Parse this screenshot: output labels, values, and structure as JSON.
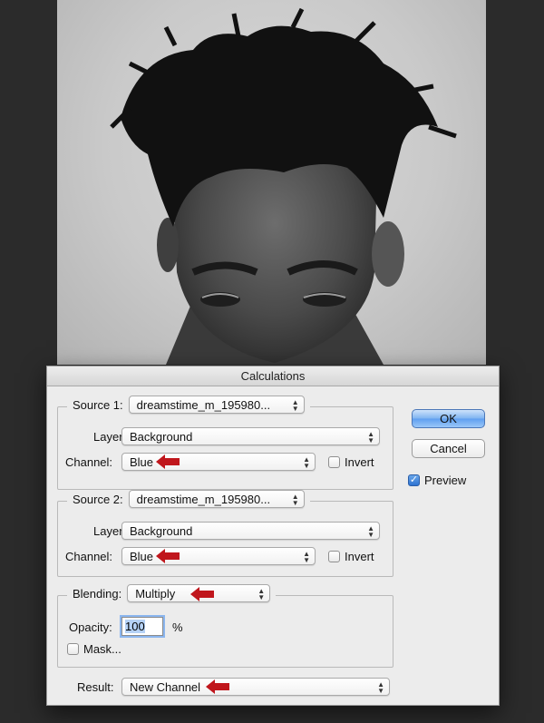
{
  "dialog": {
    "title": "Calculations",
    "source1": {
      "label": "Source 1:",
      "document": "dreamstime_m_195980...",
      "layer_label": "Layer:",
      "layer_value": "Background",
      "channel_label": "Channel:",
      "channel_value": "Blue",
      "invert_label": "Invert",
      "invert_checked": false
    },
    "source2": {
      "label": "Source 2:",
      "document": "dreamstime_m_195980...",
      "layer_label": "Layer:",
      "layer_value": "Background",
      "channel_label": "Channel:",
      "channel_value": "Blue",
      "invert_label": "Invert",
      "invert_checked": false
    },
    "blending": {
      "label": "Blending:",
      "mode": "Multiply",
      "opacity_label": "Opacity:",
      "opacity_value": "100",
      "opacity_unit": "%",
      "mask_label": "Mask...",
      "mask_checked": false
    },
    "result": {
      "label": "Result:",
      "value": "New Channel"
    },
    "buttons": {
      "ok": "OK",
      "cancel": "Cancel"
    },
    "preview": {
      "label": "Preview",
      "checked": true
    }
  },
  "annotations": {
    "arrow_color": "#c0161c"
  },
  "colors": {
    "background": "#2b2b2b",
    "dialog_bg": "#ececec",
    "default_button": "#6aa7ea"
  }
}
